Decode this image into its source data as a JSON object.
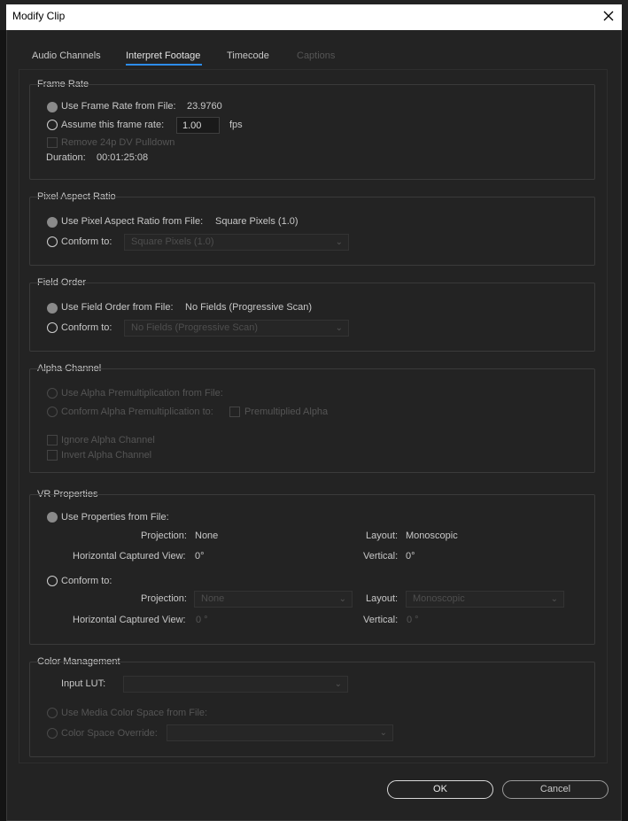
{
  "window": {
    "title": "Modify Clip"
  },
  "tabs": [
    {
      "label": "Audio Channels",
      "state": "normal"
    },
    {
      "label": "Interpret Footage",
      "state": "active"
    },
    {
      "label": "Timecode",
      "state": "normal"
    },
    {
      "label": "Captions",
      "state": "disabled"
    }
  ],
  "frame_rate": {
    "legend": "Frame Rate",
    "use_from_file_label": "Use Frame Rate from File:",
    "file_rate": "23.9760",
    "assume_label": "Assume this frame rate:",
    "assume_value": "1.00",
    "fps_unit": "fps",
    "remove_pulldown_label": "Remove 24p DV Pulldown",
    "duration_label": "Duration:",
    "duration_value": "00:01:25:08"
  },
  "pixel_aspect": {
    "legend": "Pixel Aspect Ratio",
    "use_from_file_label": "Use Pixel Aspect Ratio from File:",
    "file_value": "Square Pixels (1.0)",
    "conform_label": "Conform to:",
    "conform_value": "Square Pixels (1.0)"
  },
  "field_order": {
    "legend": "Field Order",
    "use_from_file_label": "Use Field Order from File:",
    "file_value": "No Fields (Progressive Scan)",
    "conform_label": "Conform to:",
    "conform_value": "No Fields (Progressive Scan)"
  },
  "alpha_channel": {
    "legend": "Alpha Channel",
    "use_premult_label": "Use Alpha Premultiplication from File:",
    "conform_premult_label": "Conform Alpha Premultiplication to:",
    "premultiplied_label": "Premultiplied Alpha",
    "ignore_label": "Ignore Alpha Channel",
    "invert_label": "Invert Alpha Channel"
  },
  "vr": {
    "legend": "VR Properties",
    "use_from_file_label": "Use Properties from File:",
    "projection_label": "Projection:",
    "projection_value": "None",
    "layout_label": "Layout:",
    "layout_value": "Monoscopic",
    "hcv_label": "Horizontal Captured View:",
    "hcv_value": "0°",
    "vertical_label": "Vertical:",
    "vertical_value": "0°",
    "conform_label": "Conform to:",
    "conform_projection_value": "None",
    "conform_layout_value": "Monoscopic",
    "conform_hcv_value": "0 °",
    "conform_vertical_value": "0 °"
  },
  "color_mgmt": {
    "legend": "Color Management",
    "input_lut_label": "Input LUT:",
    "input_lut_value": "",
    "use_media_label": "Use Media Color Space from File:",
    "override_label": "Color Space Override:",
    "override_value": ""
  },
  "buttons": {
    "ok": "OK",
    "cancel": "Cancel"
  },
  "icons": {
    "close": "close-icon",
    "dropdown": "chevron-down-icon"
  },
  "colors": {
    "accent": "#2d8ceb",
    "background": "#232323",
    "titlebar": "#ffffff"
  }
}
